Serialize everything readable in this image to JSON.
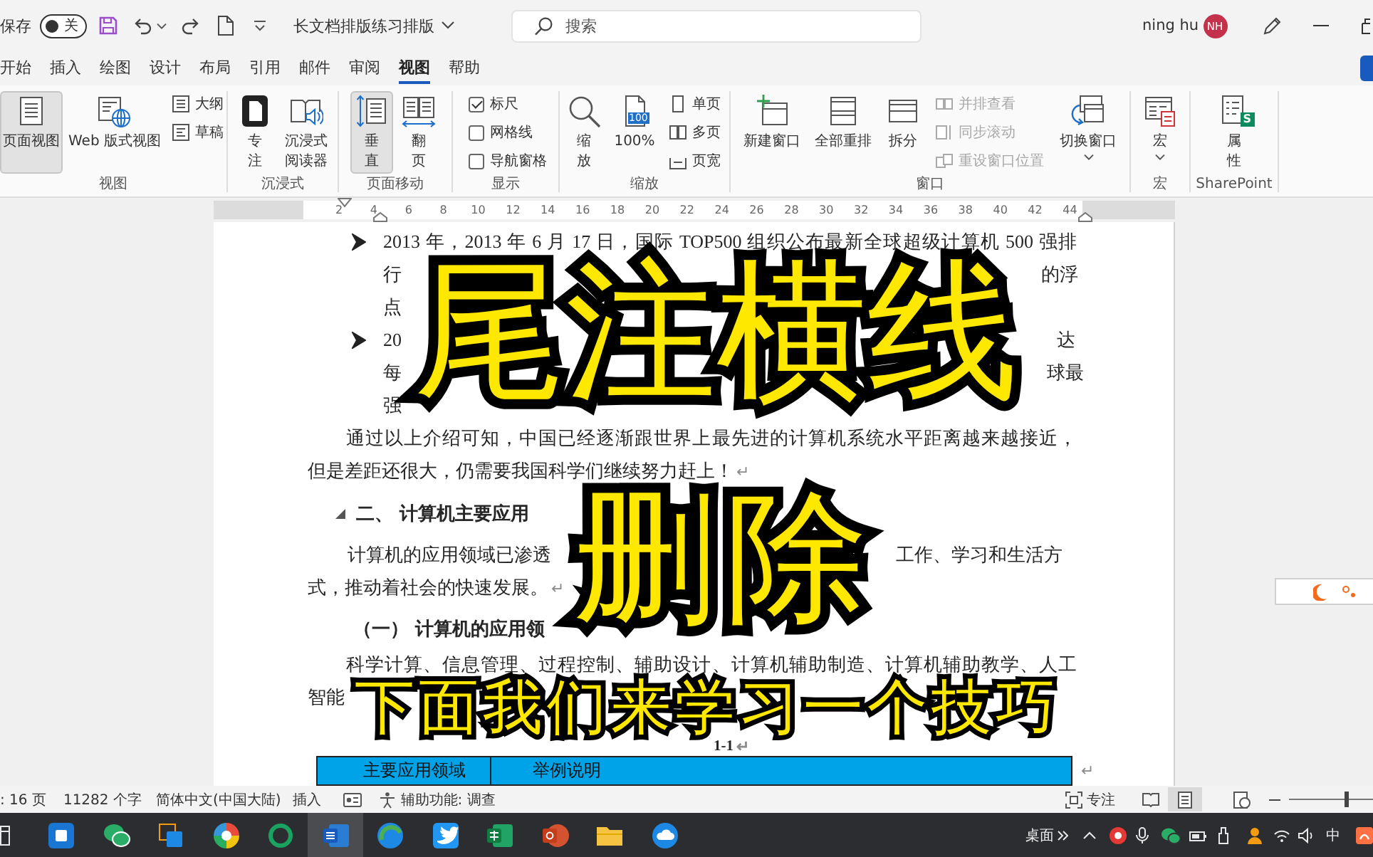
{
  "title_bar": {
    "autosave_label": "保存",
    "autosave_toggle": {
      "label": "关",
      "on": false
    },
    "document_title": "长文档排版练习排版",
    "search": {
      "placeholder": "搜索"
    },
    "user": {
      "name": "ning hu",
      "initials": "NH"
    }
  },
  "tabs": [
    {
      "label": "开始",
      "selected": false
    },
    {
      "label": "插入",
      "selected": false
    },
    {
      "label": "绘图",
      "selected": false
    },
    {
      "label": "设计",
      "selected": false
    },
    {
      "label": "布局",
      "selected": false
    },
    {
      "label": "引用",
      "selected": false
    },
    {
      "label": "邮件",
      "selected": false
    },
    {
      "label": "审阅",
      "selected": false
    },
    {
      "label": "视图",
      "selected": true
    },
    {
      "label": "帮助",
      "selected": false
    }
  ],
  "ribbon": [
    {
      "label": "视图",
      "items": [
        {
          "kind": "large",
          "label": "页面视图",
          "selected": true
        },
        {
          "kind": "large",
          "label": "Web 版式视图",
          "selected": false
        },
        {
          "kind": "small",
          "label": "大纲",
          "selected": false
        },
        {
          "kind": "small",
          "label": "草稿",
          "selected": false
        }
      ]
    },
    {
      "label": "沉浸式",
      "items": [
        {
          "kind": "stacked",
          "label": "专注"
        },
        {
          "kind": "stacked",
          "label": "沉浸式阅读器"
        }
      ]
    },
    {
      "label": "页面移动",
      "items": [
        {
          "kind": "stacked",
          "label": "垂直",
          "selected": true
        },
        {
          "kind": "stacked",
          "label": "翻页",
          "selected": false
        }
      ]
    },
    {
      "label": "显示",
      "items": [
        {
          "kind": "check",
          "label": "标尺",
          "checked": true
        },
        {
          "kind": "check",
          "label": "网格线",
          "checked": false
        },
        {
          "kind": "check",
          "label": "导航窗格",
          "checked": false
        }
      ]
    },
    {
      "label": "缩放",
      "items": [
        {
          "kind": "stacked",
          "label": "缩放"
        },
        {
          "kind": "large",
          "label": "100%",
          "badge": "100"
        },
        {
          "kind": "small",
          "label": "单页"
        },
        {
          "kind": "small",
          "label": "多页"
        },
        {
          "kind": "small",
          "label": "页宽"
        }
      ]
    },
    {
      "label": "窗口",
      "items": [
        {
          "kind": "large",
          "label": "新建窗口",
          "disabled": false
        },
        {
          "kind": "large",
          "label": "全部重排",
          "disabled": false
        },
        {
          "kind": "large",
          "label": "拆分",
          "disabled": false
        },
        {
          "kind": "small",
          "label": "并排查看",
          "disabled": true
        },
        {
          "kind": "small",
          "label": "同步滚动",
          "disabled": true
        },
        {
          "kind": "small",
          "label": "重设窗口位置",
          "disabled": true
        },
        {
          "kind": "dropdown",
          "label": "切换窗口",
          "disabled": false
        }
      ]
    },
    {
      "label": "宏",
      "items": [
        {
          "kind": "dropdown",
          "label": "宏"
        }
      ]
    },
    {
      "label": "SharePoint",
      "items": [
        {
          "kind": "stacked",
          "label": "属性",
          "badge": "S"
        }
      ]
    }
  ],
  "ruler": {
    "ticks": [
      "2",
      "4",
      "6",
      "8",
      "10",
      "12",
      "14",
      "16",
      "18",
      "20",
      "22",
      "24",
      "26",
      "28",
      "30",
      "32",
      "34",
      "36",
      "38",
      "40",
      "42",
      "44"
    ]
  },
  "document": {
    "blocks": [
      {
        "kind": "bullet",
        "lines": [
          [
            "2013 年，2013 年 6 月 17 日，国际 TOP500 组织公布最新全球超级计算机 500 强排"
          ],
          [
            "行",
            "的浮"
          ],
          [
            "点"
          ]
        ]
      },
      {
        "kind": "bullet",
        "lines": [
          [
            "20",
            "达"
          ],
          [
            "每",
            "球最"
          ],
          [
            "强"
          ]
        ]
      },
      {
        "kind": "paragraph",
        "lines": [
          [
            "通过以上介绍可知，中国已经逐渐跟世界上最先进的计算机系统水平距离越来越接近，"
          ],
          [
            "但是差距还很大，仍需要我国科学们继续努力赶上！"
          ]
        ],
        "end_mark": "↵"
      },
      {
        "kind": "heading",
        "lines": [
          [
            "二、 计算机主要应用"
          ]
        ]
      },
      {
        "kind": "paragraph",
        "lines": [
          [
            "计算机的应用领域已渗透",
            "工作、学习和生活方"
          ],
          [
            "式，推动着社会的快速发展。"
          ]
        ],
        "end_mark": "↵"
      },
      {
        "kind": "subheading",
        "lines": [
          [
            "（一） 计算机的应用领"
          ]
        ]
      },
      {
        "kind": "paragraph",
        "lines": [
          [
            "科学计算、信息管理、过程控制、辅助设计、计算机辅助制造、计算机辅助教学、人工"
          ],
          [
            "智能"
          ]
        ]
      },
      {
        "kind": "caption",
        "lines": [
          [
            "1-1"
          ]
        ],
        "end_mark": "↵"
      },
      {
        "kind": "table",
        "columns": [
          "主要应用领域",
          "举例说明"
        ],
        "end_mark": "↵"
      }
    ]
  },
  "overlay_captions": [
    {
      "kind": "title",
      "text": "尾注横线"
    },
    {
      "kind": "title",
      "text": "删除"
    },
    {
      "kind": "subtitle",
      "text": "下面我们来学习一个技巧"
    }
  ],
  "status_bar": {
    "page": ": 16 页",
    "words": "11282 个字",
    "language": "简体中文(中国大陆)",
    "mode": "插入",
    "accessibility": "辅助功能: 调查",
    "focus": "专注",
    "views": [
      {
        "selected": false
      },
      {
        "selected": true
      },
      {
        "selected": false
      }
    ],
    "zoom": {
      "level": 0.68
    }
  },
  "taskbar": {
    "apps": [
      {
        "kind": "tile",
        "selected": false
      },
      {
        "kind": "chat",
        "selected": false
      },
      {
        "kind": "squares",
        "selected": false
      },
      {
        "kind": "orb",
        "selected": false
      },
      {
        "kind": "ring",
        "selected": false
      },
      {
        "kind": "document",
        "selected": true
      },
      {
        "kind": "swirl",
        "selected": false
      },
      {
        "kind": "bird",
        "selected": false
      },
      {
        "kind": "sheet",
        "selected": false
      },
      {
        "kind": "slides",
        "selected": false
      },
      {
        "kind": "folder",
        "selected": false
      },
      {
        "kind": "cloud",
        "selected": false
      }
    ],
    "desktop_label": "桌面",
    "ime_label": "中"
  }
}
